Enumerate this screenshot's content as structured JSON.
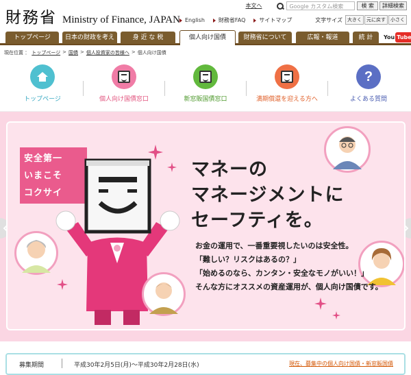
{
  "header": {
    "logo_jp": "財務省",
    "logo_en": "Ministry of Finance, JAPAN",
    "skip_link": "本文へ",
    "search_placeholder": "Google カスタム検索",
    "search_button": "検 索",
    "detail_search_button": "詳細検索",
    "util_links": [
      "English",
      "財務省FAQ",
      "サイトマップ"
    ],
    "font_size_label": "文字サイズ",
    "font_size_buttons": [
      "大きく",
      "元に戻す",
      "小さく"
    ]
  },
  "gnav": {
    "tabs": [
      "トップページ",
      "日本の財政を考える",
      "身 近 な 税",
      "個人向け国債",
      "財務省について",
      "広報・報道",
      "統  計"
    ],
    "active_index": 3,
    "youtube_left": "You",
    "youtube_right": "Tube"
  },
  "breadcrumb": {
    "label": "現在位置 ：",
    "items": [
      "トップページ",
      "国債",
      "個人投資家の皆様へ",
      "個人向け国債"
    ],
    "separator": ">"
  },
  "subnav": {
    "items": [
      {
        "label": "トップページ",
        "color": "#4fc0d0",
        "icon": "house-icon",
        "text_color": "#39a9c2"
      },
      {
        "label": "個人向け国債窓口",
        "color": "#f07ca6",
        "icon": "kokusai-character-icon",
        "text_color": "#e2557f"
      },
      {
        "label": "新窓販国債窓口",
        "color": "#62b93d",
        "icon": "kokusai-character-icon",
        "text_color": "#4f9a2e"
      },
      {
        "label": "満期償還を迎える方へ",
        "color": "#ef7045",
        "icon": "kokusai-character-icon",
        "text_color": "#e0602a"
      },
      {
        "label": "よくある質問",
        "color": "#5b6fc4",
        "icon": "question-icon",
        "text_color": "#4a5db1"
      }
    ]
  },
  "hero": {
    "badge_lines": [
      "安全第一",
      "いまこそ",
      "コクサイ"
    ],
    "headline_lines": [
      "マネーの",
      "マネージメントに",
      "セーフティを。"
    ],
    "body_lines": [
      "お金の運用で、一番重要視したいのは安全性。",
      "「難しい？リスクはあるの？」",
      "「始めるのなら、カンタン・安全なモノがいい！」",
      "そんな方にオススメの資産運用が、個人向け国債です。"
    ],
    "accent_color": "#ea5b8d"
  },
  "info_bar": {
    "label": "募集期間",
    "value": "平成30年2月5日(月)～平成30年2月28日(水)",
    "link": "現在、募集中の個人向け国債・新窓販国債"
  }
}
